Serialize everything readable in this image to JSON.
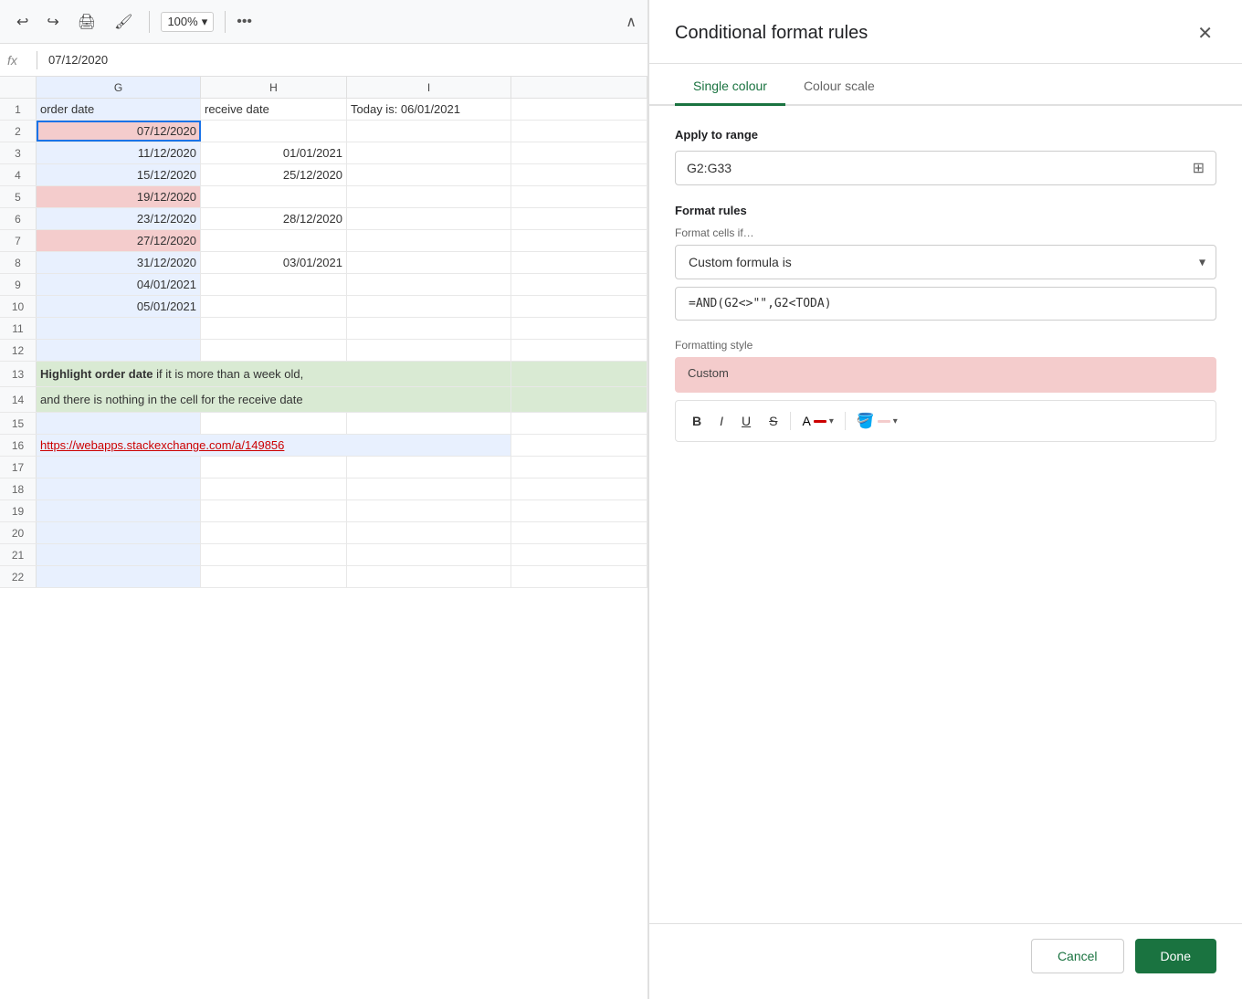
{
  "toolbar": {
    "undo_label": "↩",
    "redo_label": "↪",
    "print_label": "🖨",
    "format_paint_label": "🖌",
    "zoom_value": "100%",
    "zoom_arrow": "▾",
    "more_label": "•••",
    "collapse_label": "∧"
  },
  "formula_bar": {
    "fx_label": "fx",
    "value": "07/12/2020"
  },
  "columns": {
    "g_label": "G",
    "h_label": "H",
    "i_label": "I"
  },
  "rows": [
    {
      "num": "1",
      "g": "order date",
      "h": "receive date",
      "i": "Today is: 06/01/2021",
      "g_class": "cell-header",
      "h_class": "cell-header",
      "i_class": "cell-header"
    },
    {
      "num": "2",
      "g": "07/12/2020",
      "h": "",
      "i": "",
      "g_class": "cell-selected cell-pink"
    },
    {
      "num": "3",
      "g": "11/12/2020",
      "h": "01/01/2021",
      "i": "",
      "g_class": ""
    },
    {
      "num": "4",
      "g": "15/12/2020",
      "h": "25/12/2020",
      "i": "",
      "g_class": ""
    },
    {
      "num": "5",
      "g": "19/12/2020",
      "h": "",
      "i": "",
      "g_class": "cell-pink"
    },
    {
      "num": "6",
      "g": "23/12/2020",
      "h": "28/12/2020",
      "i": "",
      "g_class": ""
    },
    {
      "num": "7",
      "g": "27/12/2020",
      "h": "",
      "i": "",
      "g_class": "cell-pink"
    },
    {
      "num": "8",
      "g": "31/12/2020",
      "h": "03/01/2021",
      "i": "",
      "g_class": ""
    },
    {
      "num": "9",
      "g": "04/01/2021",
      "h": "",
      "i": "",
      "g_class": ""
    },
    {
      "num": "10",
      "g": "05/01/2021",
      "h": "",
      "i": "",
      "g_class": ""
    },
    {
      "num": "11",
      "g": "",
      "h": "",
      "i": "",
      "g_class": ""
    },
    {
      "num": "12",
      "g": "",
      "h": "",
      "i": "",
      "g_class": ""
    },
    {
      "num": "13",
      "g": "Highlight order date if it is more than a week old,",
      "h": "",
      "i": "",
      "g_class": "cell-green tall-text",
      "colspan": true
    },
    {
      "num": "14",
      "g": "and there is nothing in the cell for the receive date",
      "h": "",
      "i": "",
      "g_class": "cell-green tall-text",
      "colspan": true
    },
    {
      "num": "15",
      "g": "",
      "h": "",
      "i": "",
      "g_class": ""
    },
    {
      "num": "16",
      "g": "https://webapps.stackexchange.com/a/149856",
      "h": "",
      "i": "",
      "g_class": "link-cell",
      "colspan": true
    },
    {
      "num": "17",
      "g": "",
      "h": "",
      "i": "",
      "g_class": ""
    },
    {
      "num": "18",
      "g": "",
      "h": "",
      "i": "",
      "g_class": ""
    },
    {
      "num": "19",
      "g": "",
      "h": "",
      "i": "",
      "g_class": ""
    },
    {
      "num": "20",
      "g": "",
      "h": "",
      "i": "",
      "g_class": ""
    },
    {
      "num": "21",
      "g": "",
      "h": "",
      "i": "",
      "g_class": ""
    },
    {
      "num": "22",
      "g": "",
      "h": "",
      "i": "",
      "g_class": ""
    }
  ],
  "panel": {
    "title": "Conditional format rules",
    "close_label": "✕",
    "tabs": [
      {
        "label": "Single colour",
        "active": true
      },
      {
        "label": "Colour scale",
        "active": false
      }
    ],
    "apply_to_range_label": "Apply to range",
    "range_value": "G2:G33",
    "grid_icon": "⊞",
    "format_rules_label": "Format rules",
    "format_cells_if_label": "Format cells if…",
    "formula_type": "Custom formula is",
    "formula_value": "=AND(G2<>\"\",G2<TODA)",
    "formatting_style_label": "Formatting style",
    "custom_label": "Custom",
    "style_buttons": {
      "bold": "B",
      "italic": "I",
      "underline": "U",
      "strikethrough": "S"
    },
    "font_color_label": "A",
    "fill_color_swatch": "#f4cccc",
    "font_color_swatch": "#cc0000",
    "cancel_label": "Cancel",
    "done_label": "Done"
  }
}
